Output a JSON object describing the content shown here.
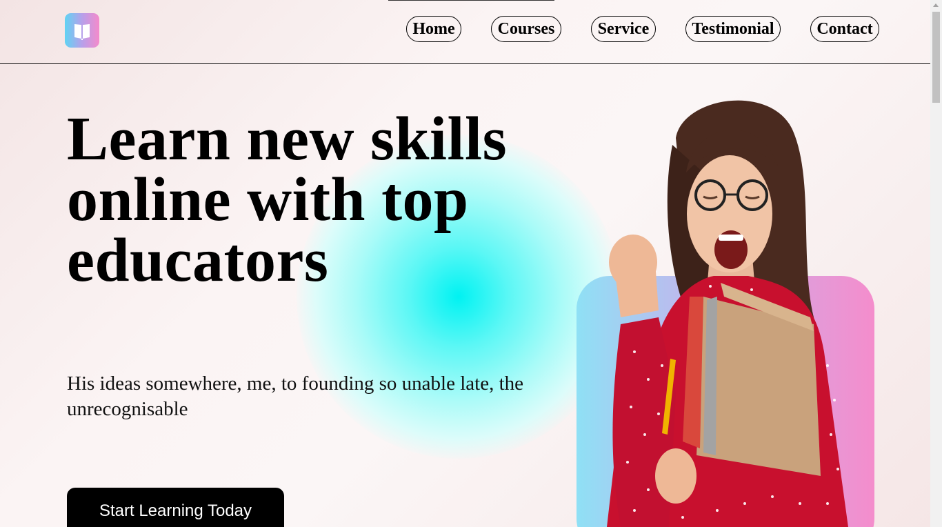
{
  "header": {
    "logo_icon": "open-book-icon",
    "nav": [
      {
        "label": "Home"
      },
      {
        "label": "Courses"
      },
      {
        "label": "Service"
      },
      {
        "label": "Testimonial"
      },
      {
        "label": "Contact"
      }
    ]
  },
  "hero": {
    "headline": "Learn new skills online with top educators",
    "subtext": "His ideas somewhere, me, to founding so unable late, the unrecognisable",
    "cta_label": "Start Learning Today"
  },
  "colors": {
    "accent_cyan": "#00f2f2",
    "card_gradient_start": "#8fe0f5",
    "card_gradient_end": "#f48dcc",
    "cta_background": "#000000"
  }
}
